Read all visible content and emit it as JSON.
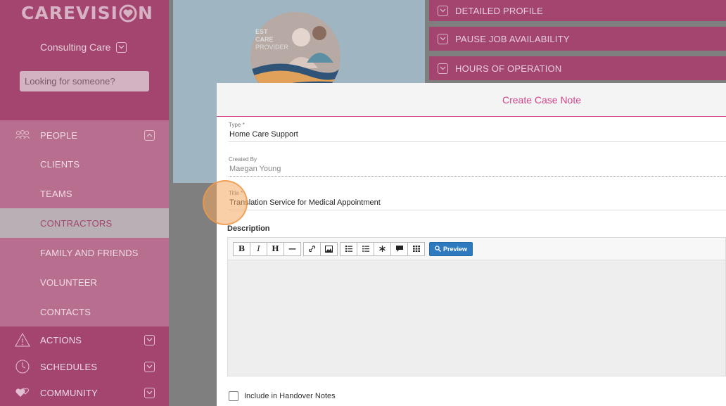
{
  "brand": {
    "logo_left": "CAREVISI",
    "logo_right": "N"
  },
  "org": {
    "name": "Consulting Care"
  },
  "search": {
    "placeholder": "Looking for someone?"
  },
  "nav": {
    "people": "PEOPLE",
    "clients": "CLIENTS",
    "teams": "TEAMS",
    "contractors": "CONTRACTORS",
    "family": "FAMILY AND FRIENDS",
    "volunteer": "VOLUNTEER",
    "contacts": "CONTACTS",
    "actions": "ACTIONS",
    "schedules": "SCHEDULES",
    "community": "COMMUNITY"
  },
  "hero": {
    "text_line1": "EST",
    "text_line2": "CARE",
    "text_line3": "PROVIDER"
  },
  "profile_options": [
    "DETAILED PROFILE",
    "PAUSE JOB AVAILABILITY",
    "HOURS OF OPERATION"
  ],
  "modal": {
    "title": "Create Case Note",
    "type": {
      "label": "Type *",
      "value": "Home Care Support"
    },
    "created_by": {
      "label": "Created By",
      "value": "Maegan Young"
    },
    "title_field": {
      "label": "Title *",
      "value": "Translation Service for Medical Appointment"
    },
    "description_label": "Description",
    "toolbar": {
      "bold": "B",
      "italic": "I",
      "heading": "H",
      "hr": "—",
      "preview": "Preview"
    },
    "handover_label": "Include in Handover Notes"
  },
  "colors": {
    "brand": "#a3456f",
    "accent": "#d6458b",
    "preview": "#2f7abf"
  }
}
